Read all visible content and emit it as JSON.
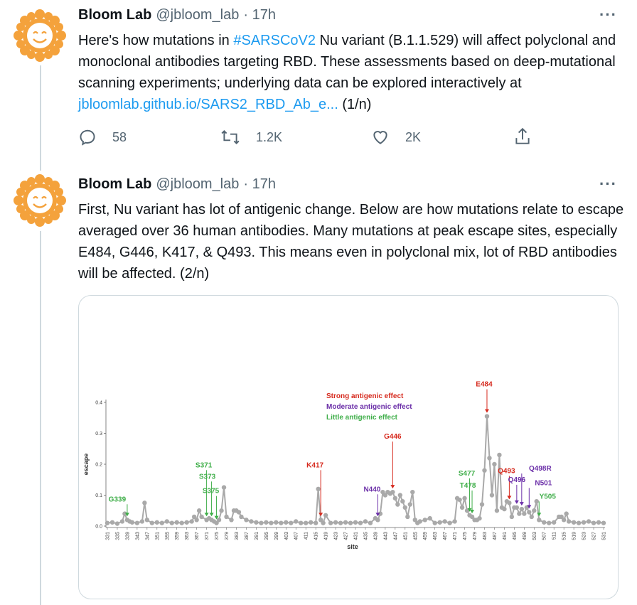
{
  "tweets": [
    {
      "name": "Bloom Lab",
      "handle": "@jbloom_lab",
      "time": "· 17h",
      "more": "···",
      "text_parts": [
        "Here's how mutations in ",
        "#SARSCoV2",
        " Nu variant (B.1.1.529) will affect polyclonal and monoclonal antibodies targeting RBD. These assessments based on deep-mutational scanning experiments; underlying data can be explored interactively at ",
        "jbloomlab.github.io/SARS2_RBD_Ab_e...",
        " (1/n)"
      ],
      "stats": {
        "replies": "58",
        "retweets": "1.2K",
        "likes": "2K"
      }
    },
    {
      "name": "Bloom Lab",
      "handle": "@jbloom_lab",
      "time": "· 17h",
      "more": "···",
      "text": "First, Nu variant has lot of antigenic change. Below are how mutations relate to escape averaged over 36 human antibodies. Many mutations at peak escape sites, especially E484, G446, K417, & Q493. This means even in polyclonal mix, lot of RBD antibodies will be affected. (2/n)"
    }
  ],
  "colors": {
    "strong": "#d62a1e",
    "moderate": "#6b2fa8",
    "little": "#3fae49",
    "line": "#a9a9a9",
    "link": "#1d9bf0"
  },
  "chart_data": {
    "type": "line",
    "xlabel": "site",
    "ylabel": "escape",
    "ylim": [
      0,
      0.4
    ],
    "yticks": [
      "0.0",
      "0.1",
      "0.2",
      "0.3",
      "0.4"
    ],
    "xticks": [
      "331",
      "335",
      "339",
      "343",
      "347",
      "351",
      "355",
      "359",
      "363",
      "367",
      "371",
      "375",
      "379",
      "383",
      "387",
      "391",
      "395",
      "399",
      "403",
      "407",
      "411",
      "415",
      "419",
      "423",
      "427",
      "431",
      "435",
      "439",
      "443",
      "447",
      "451",
      "455",
      "459",
      "463",
      "467",
      "471",
      "475",
      "479",
      "483",
      "487",
      "491",
      "495",
      "499",
      "503",
      "507",
      "511",
      "515",
      "519",
      "523",
      "527",
      "531"
    ],
    "legend": [
      {
        "label": "Strong antigenic effect",
        "color": "strong"
      },
      {
        "label": "Moderate antigenic effect",
        "color": "moderate"
      },
      {
        "label": "Little antigenic effect",
        "color": "little"
      }
    ],
    "points": [
      [
        331,
        0.01
      ],
      [
        333,
        0.012
      ],
      [
        335,
        0.008
      ],
      [
        337,
        0.015
      ],
      [
        338,
        0.04
      ],
      [
        339,
        0.02
      ],
      [
        340,
        0.015
      ],
      [
        341,
        0.012
      ],
      [
        343,
        0.01
      ],
      [
        345,
        0.015
      ],
      [
        346,
        0.075
      ],
      [
        347,
        0.02
      ],
      [
        349,
        0.01
      ],
      [
        351,
        0.012
      ],
      [
        353,
        0.01
      ],
      [
        355,
        0.015
      ],
      [
        357,
        0.01
      ],
      [
        359,
        0.012
      ],
      [
        361,
        0.01
      ],
      [
        363,
        0.012
      ],
      [
        365,
        0.015
      ],
      [
        366,
        0.03
      ],
      [
        367,
        0.02
      ],
      [
        368,
        0.05
      ],
      [
        369,
        0.03
      ],
      [
        371,
        0.02
      ],
      [
        372,
        0.025
      ],
      [
        373,
        0.02
      ],
      [
        374,
        0.015
      ],
      [
        375,
        0.01
      ],
      [
        376,
        0.02
      ],
      [
        377,
        0.05
      ],
      [
        378,
        0.125
      ],
      [
        379,
        0.03
      ],
      [
        381,
        0.02
      ],
      [
        382,
        0.05
      ],
      [
        383,
        0.05
      ],
      [
        384,
        0.045
      ],
      [
        385,
        0.03
      ],
      [
        387,
        0.02
      ],
      [
        389,
        0.015
      ],
      [
        391,
        0.012
      ],
      [
        393,
        0.01
      ],
      [
        395,
        0.012
      ],
      [
        397,
        0.01
      ],
      [
        399,
        0.012
      ],
      [
        401,
        0.01
      ],
      [
        403,
        0.012
      ],
      [
        405,
        0.01
      ],
      [
        407,
        0.015
      ],
      [
        409,
        0.01
      ],
      [
        411,
        0.01
      ],
      [
        413,
        0.012
      ],
      [
        415,
        0.01
      ],
      [
        416,
        0.12
      ],
      [
        417,
        0.02
      ],
      [
        418,
        0.01
      ],
      [
        419,
        0.035
      ],
      [
        421,
        0.01
      ],
      [
        423,
        0.012
      ],
      [
        425,
        0.01
      ],
      [
        427,
        0.012
      ],
      [
        429,
        0.01
      ],
      [
        431,
        0.012
      ],
      [
        433,
        0.01
      ],
      [
        435,
        0.015
      ],
      [
        437,
        0.01
      ],
      [
        439,
        0.025
      ],
      [
        440,
        0.02
      ],
      [
        441,
        0.04
      ],
      [
        442,
        0.11
      ],
      [
        443,
        0.1
      ],
      [
        444,
        0.11
      ],
      [
        445,
        0.105
      ],
      [
        446,
        0.11
      ],
      [
        447,
        0.09
      ],
      [
        448,
        0.07
      ],
      [
        449,
        0.1
      ],
      [
        450,
        0.08
      ],
      [
        451,
        0.06
      ],
      [
        452,
        0.03
      ],
      [
        453,
        0.07
      ],
      [
        454,
        0.11
      ],
      [
        455,
        0.02
      ],
      [
        456,
        0.01
      ],
      [
        457,
        0.015
      ],
      [
        459,
        0.02
      ],
      [
        461,
        0.025
      ],
      [
        463,
        0.01
      ],
      [
        465,
        0.012
      ],
      [
        467,
        0.015
      ],
      [
        469,
        0.01
      ],
      [
        471,
        0.015
      ],
      [
        472,
        0.09
      ],
      [
        473,
        0.085
      ],
      [
        474,
        0.06
      ],
      [
        475,
        0.09
      ],
      [
        476,
        0.05
      ],
      [
        477,
        0.035
      ],
      [
        478,
        0.03
      ],
      [
        479,
        0.02
      ],
      [
        480,
        0.02
      ],
      [
        481,
        0.025
      ],
      [
        482,
        0.07
      ],
      [
        483,
        0.18
      ],
      [
        484,
        0.355
      ],
      [
        485,
        0.22
      ],
      [
        486,
        0.1
      ],
      [
        487,
        0.2
      ],
      [
        488,
        0.05
      ],
      [
        489,
        0.23
      ],
      [
        490,
        0.06
      ],
      [
        491,
        0.055
      ],
      [
        492,
        0.08
      ],
      [
        493,
        0.075
      ],
      [
        494,
        0.03
      ],
      [
        495,
        0.06
      ],
      [
        496,
        0.06
      ],
      [
        497,
        0.04
      ],
      [
        498,
        0.055
      ],
      [
        499,
        0.04
      ],
      [
        500,
        0.06
      ],
      [
        501,
        0.045
      ],
      [
        502,
        0.03
      ],
      [
        503,
        0.05
      ],
      [
        504,
        0.08
      ],
      [
        505,
        0.02
      ],
      [
        507,
        0.012
      ],
      [
        509,
        0.01
      ],
      [
        511,
        0.012
      ],
      [
        513,
        0.03
      ],
      [
        514,
        0.03
      ],
      [
        515,
        0.02
      ],
      [
        516,
        0.04
      ],
      [
        517,
        0.015
      ],
      [
        519,
        0.012
      ],
      [
        521,
        0.01
      ],
      [
        523,
        0.012
      ],
      [
        525,
        0.015
      ],
      [
        527,
        0.01
      ],
      [
        529,
        0.012
      ],
      [
        531,
        0.01
      ]
    ],
    "annotations": [
      {
        "label": "G339",
        "site": 339,
        "effect": "little"
      },
      {
        "label": "S371",
        "site": 371,
        "effect": "little"
      },
      {
        "label": "S373",
        "site": 373,
        "effect": "little"
      },
      {
        "label": "S375",
        "site": 375,
        "effect": "little"
      },
      {
        "label": "K417",
        "site": 417,
        "effect": "strong"
      },
      {
        "label": "N440",
        "site": 440,
        "effect": "moderate"
      },
      {
        "label": "G446",
        "site": 446,
        "effect": "strong"
      },
      {
        "label": "S477",
        "site": 477,
        "effect": "little"
      },
      {
        "label": "T478",
        "site": 478,
        "effect": "little"
      },
      {
        "label": "E484",
        "site": 484,
        "effect": "strong"
      },
      {
        "label": "Q493",
        "site": 493,
        "effect": "strong"
      },
      {
        "label": "Q496",
        "site": 496,
        "effect": "moderate"
      },
      {
        "label": "Q498R",
        "site": 498,
        "effect": "moderate"
      },
      {
        "label": "N501",
        "site": 501,
        "effect": "moderate"
      },
      {
        "label": "Y505",
        "site": 505,
        "effect": "little"
      }
    ]
  }
}
